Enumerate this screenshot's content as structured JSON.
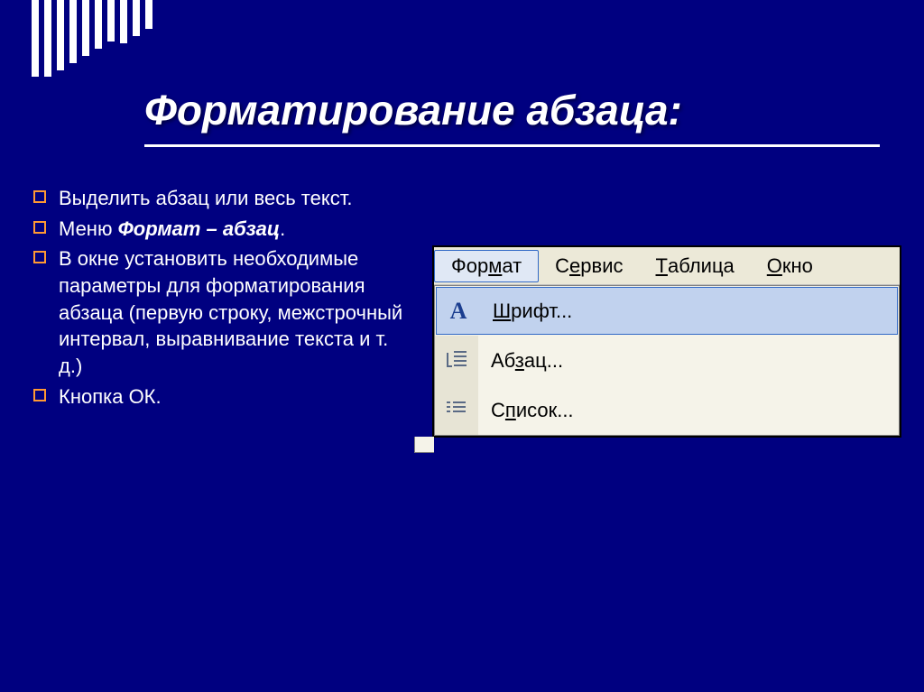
{
  "title": "Форматирование абзаца:",
  "stripes": [
    85,
    85,
    78,
    70,
    62,
    54,
    46,
    48,
    40,
    32
  ],
  "bullets": [
    {
      "pre": "Выделить абзац или весь текст.",
      "bold": "",
      "post": ""
    },
    {
      "pre": "Меню ",
      "bold": "Формат – абзац",
      "post": "."
    },
    {
      "pre": "В окне установить необходимые параметры для форматирования абзаца (первую строку, межстрочный интервал, выравнивание текста и т. д.)",
      "bold": "",
      "post": ""
    },
    {
      "pre": "Кнопка ОК.",
      "bold": "",
      "post": ""
    }
  ],
  "menubar": {
    "items": [
      {
        "prefix": "Фор",
        "u": "м",
        "suffix": "ат",
        "active": true
      },
      {
        "prefix": "С",
        "u": "е",
        "suffix": "рвис",
        "active": false
      },
      {
        "prefix": "",
        "u": "Т",
        "suffix": "аблица",
        "active": false
      },
      {
        "prefix": "",
        "u": "О",
        "suffix": "кно",
        "active": false
      }
    ]
  },
  "dropdown": {
    "items": [
      {
        "icon": "a",
        "u": "Ш",
        "rest": "рифт...",
        "selected": true
      },
      {
        "icon": "para",
        "u": "",
        "rest": "Аб",
        "u2": "з",
        "rest2": "ац...",
        "selected": false
      },
      {
        "icon": "list",
        "u": "",
        "rest": "С",
        "u2": "п",
        "rest2": "исок...",
        "selected": false
      }
    ]
  }
}
